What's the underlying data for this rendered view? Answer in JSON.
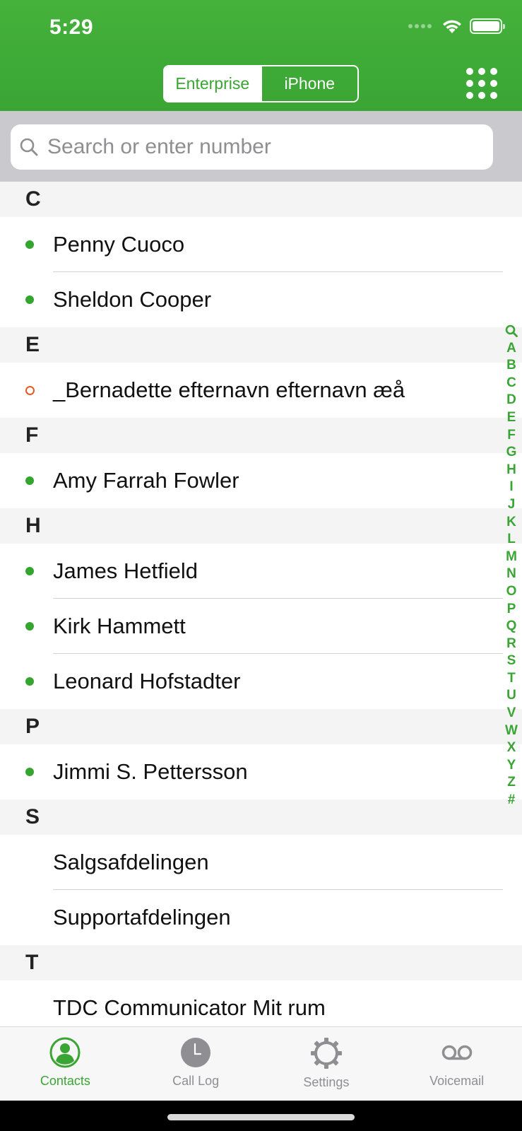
{
  "status_bar": {
    "time": "5:29"
  },
  "header": {
    "segments": [
      {
        "label": "Enterprise",
        "selected": true
      },
      {
        "label": "iPhone",
        "selected": false
      }
    ],
    "dialpad_icon": "dialpad-grid-icon"
  },
  "search": {
    "placeholder": "Search or enter number",
    "value": ""
  },
  "sections": [
    {
      "letter": "C",
      "contacts": [
        {
          "name": "Penny Cuoco",
          "presence": "online"
        },
        {
          "name": "Sheldon Cooper",
          "presence": "online"
        }
      ]
    },
    {
      "letter": "E",
      "contacts": [
        {
          "name": "_Bernadette efternavn efternavn æå",
          "presence": "offline"
        }
      ]
    },
    {
      "letter": "F",
      "contacts": [
        {
          "name": "Amy Farrah Fowler",
          "presence": "online"
        }
      ]
    },
    {
      "letter": "H",
      "contacts": [
        {
          "name": "James Hetfield",
          "presence": "online"
        },
        {
          "name": "Kirk Hammett",
          "presence": "online"
        },
        {
          "name": "Leonard Hofstadter",
          "presence": "online"
        }
      ]
    },
    {
      "letter": "P",
      "contacts": [
        {
          "name": "Jimmi S. Pettersson",
          "presence": "online"
        }
      ]
    },
    {
      "letter": "S",
      "contacts": [
        {
          "name": "Salgsafdelingen",
          "presence": "none"
        },
        {
          "name": "Supportafdelingen",
          "presence": "none"
        }
      ]
    },
    {
      "letter": "T",
      "contacts": [
        {
          "name": "TDC Communicator Mit rum",
          "presence": "none"
        }
      ]
    }
  ],
  "index_letters": [
    "A",
    "B",
    "C",
    "D",
    "E",
    "F",
    "G",
    "H",
    "I",
    "J",
    "K",
    "L",
    "M",
    "N",
    "O",
    "P",
    "Q",
    "R",
    "S",
    "T",
    "U",
    "V",
    "W",
    "X",
    "Y",
    "Z",
    "#"
  ],
  "tabs": [
    {
      "label": "Contacts",
      "icon": "contacts-icon",
      "active": true
    },
    {
      "label": "Call Log",
      "icon": "clock-icon",
      "active": false
    },
    {
      "label": "Settings",
      "icon": "gear-icon",
      "active": false
    },
    {
      "label": "Voicemail",
      "icon": "voicemail-icon",
      "active": false
    }
  ],
  "colors": {
    "brand_green": "#3aa534",
    "offline_orange": "#e35a22",
    "inactive_gray": "#8e8e93"
  }
}
